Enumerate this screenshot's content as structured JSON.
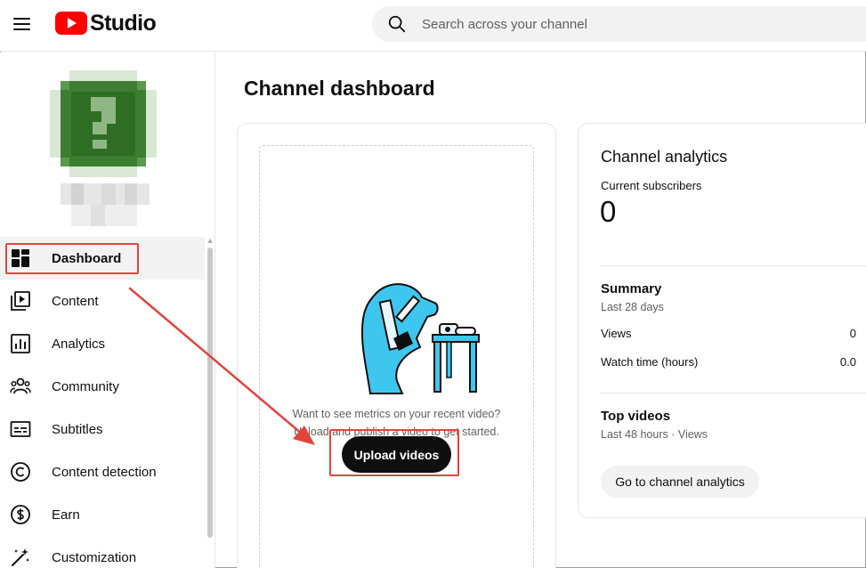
{
  "app": {
    "logo_text": "Studio"
  },
  "search": {
    "placeholder": "Search across your channel"
  },
  "sidebar": {
    "items": [
      {
        "label": "Dashboard",
        "icon": "dashboard-icon",
        "active": true
      },
      {
        "label": "Content",
        "icon": "content-icon",
        "active": false
      },
      {
        "label": "Analytics",
        "icon": "analytics-icon",
        "active": false
      },
      {
        "label": "Community",
        "icon": "community-icon",
        "active": false
      },
      {
        "label": "Subtitles",
        "icon": "subtitles-icon",
        "active": false
      },
      {
        "label": "Content detection",
        "icon": "copyright-icon",
        "active": false
      },
      {
        "label": "Earn",
        "icon": "dollar-icon",
        "active": false
      },
      {
        "label": "Customization",
        "icon": "magic-wand-icon",
        "active": false
      }
    ]
  },
  "main": {
    "page_title": "Channel dashboard",
    "upload_card": {
      "line1": "Want to see metrics on your recent video?",
      "line2": "Upload and publish a video to get started.",
      "button_label": "Upload videos"
    },
    "analytics_card": {
      "title": "Channel analytics",
      "subscribers_label": "Current subscribers",
      "subscribers_value": "0",
      "summary_title": "Summary",
      "summary_period": "Last 28 days",
      "metrics": [
        {
          "label": "Views",
          "value": "0"
        },
        {
          "label": "Watch time (hours)",
          "value": "0.0"
        }
      ],
      "top_videos_title": "Top videos",
      "top_videos_period": "Last 48 hours · Views",
      "go_button_label": "Go to channel analytics"
    }
  },
  "colors": {
    "brand_red": "#ff0000",
    "annotation_red": "#e0453c",
    "primary_button": "#0f0f0f",
    "illustration_cyan": "#3ec7ee"
  }
}
